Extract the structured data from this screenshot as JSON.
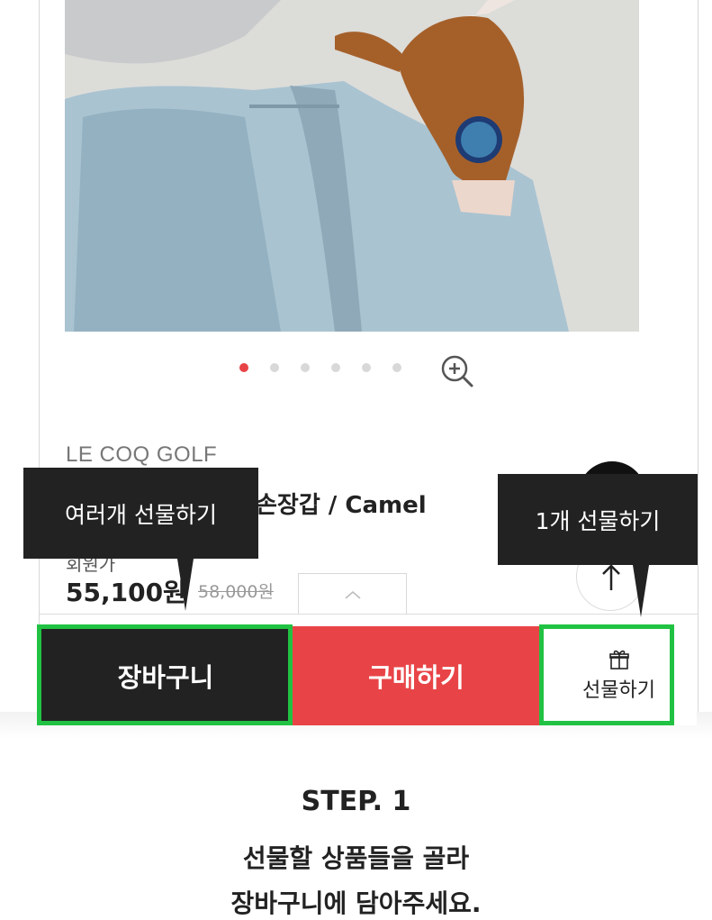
{
  "product": {
    "brand": "LE COQ GOLF",
    "name": "손장갑 / Camel",
    "price_label": "회원가",
    "price": "55,100원",
    "original_price": "58,000원"
  },
  "carousel": {
    "total_slides": 6,
    "active_index": 0
  },
  "tooltips": {
    "multi_gift": "여러개 선물하기",
    "single_gift": "1개 선물하기"
  },
  "actions": {
    "cart_label": "장바구니",
    "buy_label": "구매하기",
    "gift_label": "선물하기"
  },
  "step": {
    "title": "STEP. 1",
    "line1": "선물할 상품들을 골라",
    "line2": "장바구니에 담아주세요."
  },
  "colors": {
    "accent_red": "#e84447",
    "dark": "#222222",
    "highlight_green": "#21c243"
  },
  "icons": [
    "zoom-in-icon",
    "arrow-up-icon",
    "chevron-up-icon",
    "gift-icon"
  ]
}
